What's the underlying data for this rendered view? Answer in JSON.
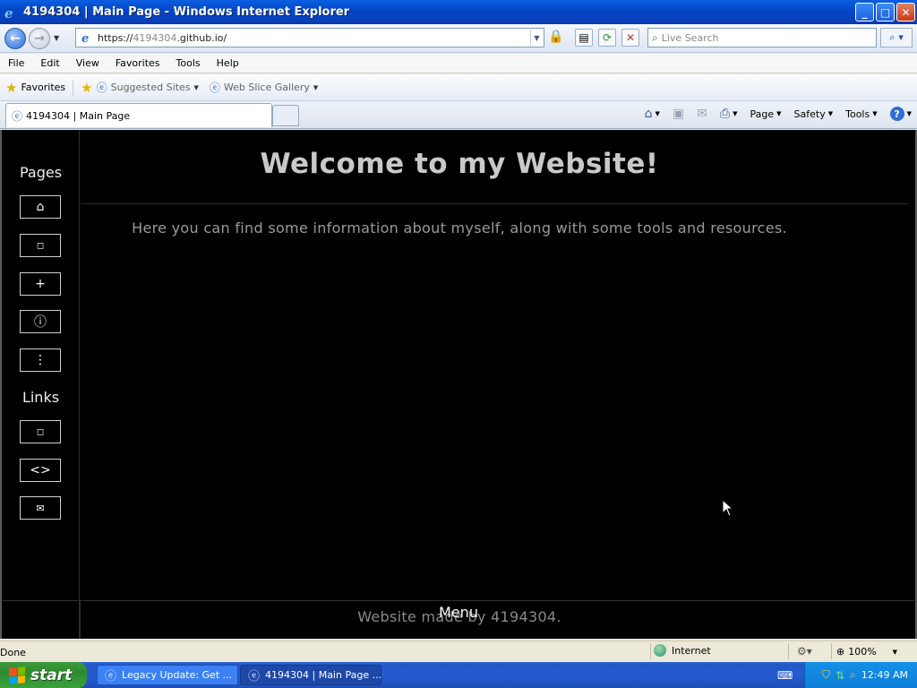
{
  "window": {
    "title": "4194304 | Main Page - Windows Internet Explorer",
    "minimize": "_",
    "maximize": "□",
    "close": "✕"
  },
  "addressbar": {
    "url_prefix": "https://",
    "url_dim": "4194304",
    "url_host": ".github.io/",
    "search_placeholder": "Live Search"
  },
  "menubar": {
    "items": [
      "File",
      "Edit",
      "View",
      "Favorites",
      "Tools",
      "Help"
    ]
  },
  "favorites_bar": {
    "favorites_label": "Favorites",
    "suggested_sites": "Suggested Sites",
    "web_slice_gallery": "Web Slice Gallery"
  },
  "tabs": {
    "active_tab": "4194304 | Main Page"
  },
  "command_bar": {
    "page": "Page",
    "safety": "Safety",
    "tools": "Tools"
  },
  "page": {
    "sidebar_pages_heading": "Pages",
    "sidebar_links_heading": "Links",
    "nav_icons": {
      "home": "⌂",
      "square1": "◻",
      "plus": "+",
      "info": "ⓘ",
      "more": "⋮",
      "square2": "◻",
      "code": "<>",
      "mail": "✉"
    },
    "title": "Welcome to my Website!",
    "intro": "Here you can find some information about myself, along with some tools and resources.",
    "footer": "Website made by 4194304.",
    "menu_label": "Menu"
  },
  "statusbar": {
    "status": "Done",
    "zone": "Internet",
    "zoom": "100%"
  },
  "taskbar": {
    "start": "start",
    "tasks": [
      "Legacy Update: Get ...",
      "4194304 | Main Page ..."
    ],
    "clock": "12:49 AM"
  }
}
